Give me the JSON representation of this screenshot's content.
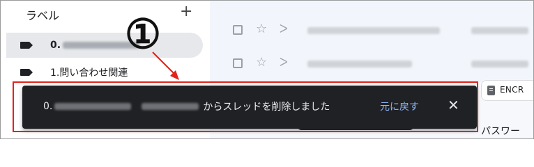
{
  "sidebar": {
    "title": "ラベル",
    "add_glyph": "+",
    "items": [
      {
        "label": "0.",
        "blurred": true,
        "suffix": "..",
        "active": true
      },
      {
        "label": "1.問い合わせ関連",
        "active": false
      }
    ]
  },
  "mail_list": {
    "rows": [
      {
        "checkbox": "unchecked",
        "starred": false
      },
      {
        "checkbox": "unchecked",
        "starred": false
      }
    ],
    "chip_text": "ENCR",
    "bottom_text": "パスワー"
  },
  "snackbar": {
    "prefix": "0.",
    "message": "からスレッドを削除しました",
    "undo_label": "元に戻す",
    "close_glyph": "✕"
  },
  "annotation": {
    "badge": "①",
    "color": "#e2231a"
  },
  "colors": {
    "snackbar_bg": "#202124",
    "link": "#8ab4f8",
    "active_label_bg": "#e7e8eb",
    "list_bg": "#f2f6fc"
  }
}
